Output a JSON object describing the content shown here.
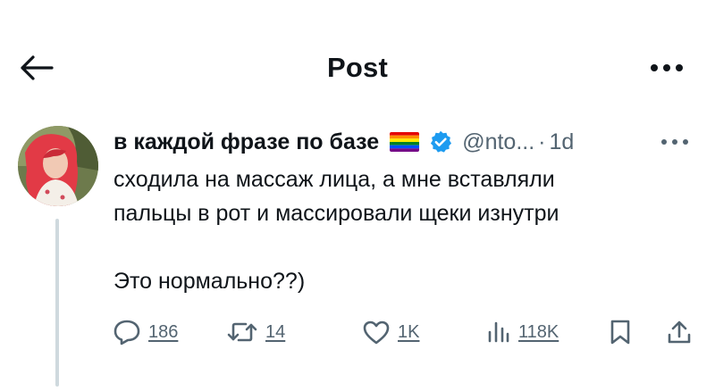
{
  "header": {
    "title": "Post",
    "back_icon": "arrow-left-icon",
    "more_icon": "more-horizontal-icon"
  },
  "tweet": {
    "display_name": "в каждой фразе по базе",
    "flag_icon": "rainbow-flag-icon",
    "verified_icon": "verified-badge-icon",
    "handle": "@nto...",
    "separator": "·",
    "time": "1d",
    "text_line_1": "сходила на массаж лица, а мне вставляли",
    "text_line_2": "пальцы в рот и массировали щеки изнутри",
    "text_line_3": "Это нормально??)"
  },
  "actions": {
    "reply_count": "186",
    "repost_count": "14",
    "like_count": "1K",
    "view_count": "118K",
    "reply_icon": "reply-icon",
    "repost_icon": "repost-icon",
    "like_icon": "heart-icon",
    "view_icon": "analytics-icon",
    "bookmark_icon": "bookmark-icon",
    "share_icon": "share-icon"
  },
  "colors": {
    "text": "#0f1419",
    "secondary": "#536471",
    "verified": "#1d9bf0",
    "thread_line": "#cfd9de"
  }
}
